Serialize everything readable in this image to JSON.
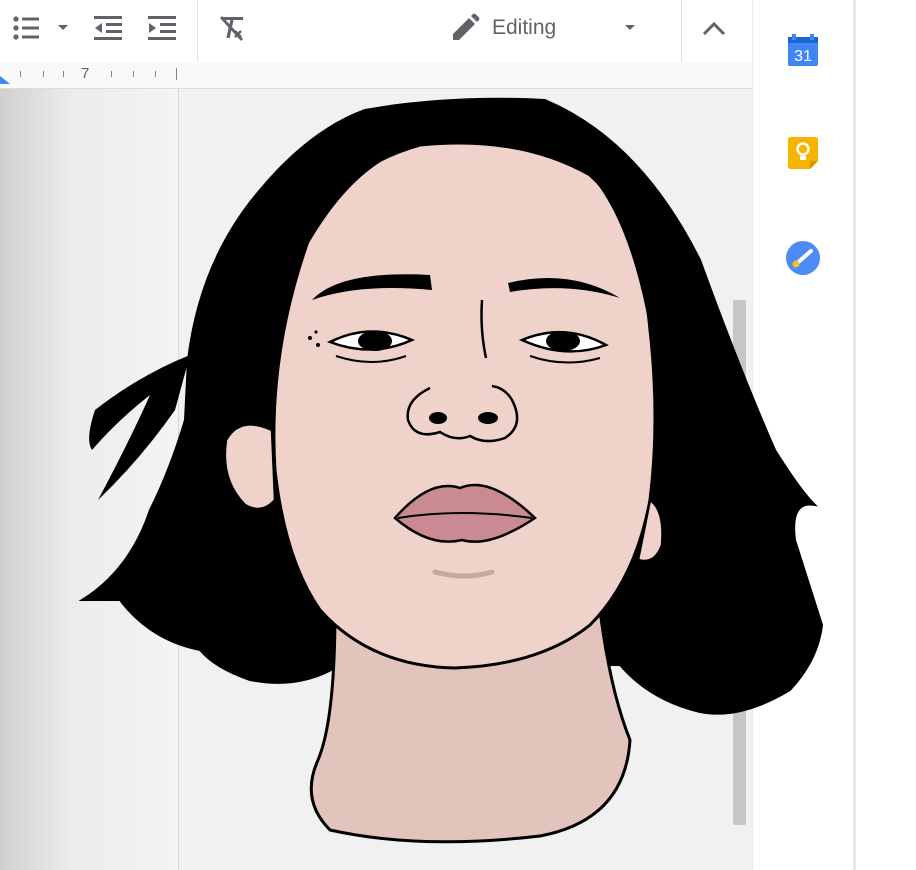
{
  "toolbar": {
    "icons": [
      "bulleted-list-icon",
      "dropdown-arrow-icon",
      "decrease-indent-icon",
      "increase-indent-icon",
      "clear-formatting-icon",
      "pencil-icon",
      "chevron-up-icon"
    ],
    "mode_label": "Editing"
  },
  "ruler": {
    "marker": "7"
  },
  "side_panel": {
    "calendar_day": "31",
    "icons": [
      "calendar-icon",
      "keep-icon",
      "tasks-icon"
    ]
  },
  "colors": {
    "skin": "#efd3cb",
    "neck": "#e3c4bd",
    "lips": "#c98a91",
    "hair": "#000000",
    "calendar_blue": "#4285f4",
    "keep_yellow": "#f6b400",
    "tasks_blue": "#4c8bf5"
  }
}
